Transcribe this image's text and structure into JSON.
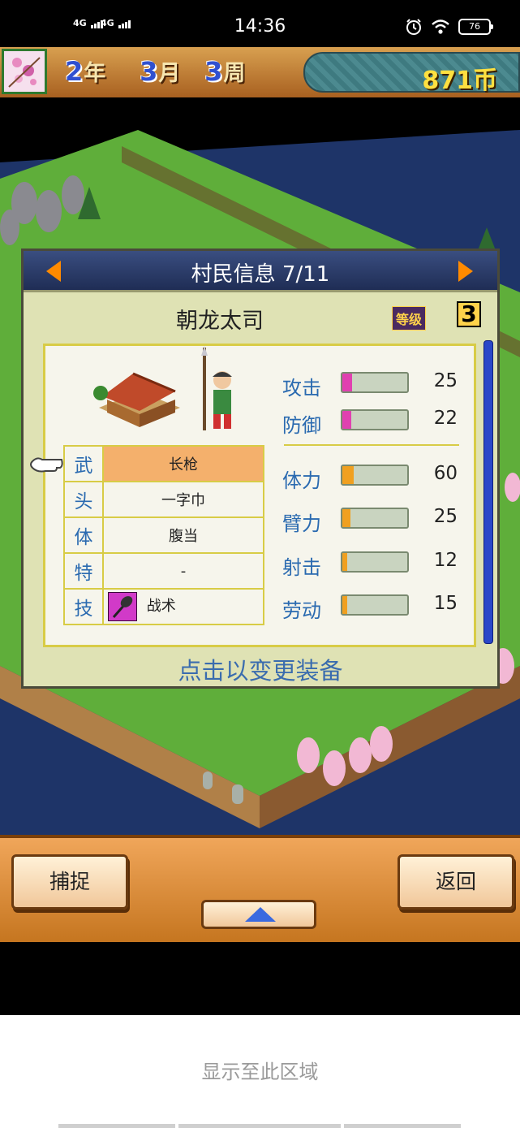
{
  "status_bar": {
    "time": "14:36",
    "signal_1": "4G",
    "signal_2": "4G",
    "battery": "76"
  },
  "top_bar": {
    "year_num": "2",
    "year_unit": "年",
    "month_num": "3",
    "month_unit": "月",
    "week_num": "3",
    "week_unit": "周",
    "coins": "871币"
  },
  "dialog": {
    "title": "村民信息 7/11",
    "villager_name": "朝龙太司",
    "level_label": "等级",
    "level_value": "3",
    "equipment": [
      {
        "slot": "武",
        "item": "长枪"
      },
      {
        "slot": "头",
        "item": "一字巾"
      },
      {
        "slot": "体",
        "item": "腹当"
      },
      {
        "slot": "特",
        "item": "-"
      },
      {
        "slot": "技",
        "item": "战术"
      }
    ],
    "stats": [
      {
        "label": "攻击",
        "value": "25",
        "fill": 0.15,
        "color": "#e040b0"
      },
      {
        "label": "防御",
        "value": "22",
        "fill": 0.14,
        "color": "#e040b0"
      },
      {
        "label": "体力",
        "value": "60",
        "fill": 0.17,
        "color": "#f0a020"
      },
      {
        "label": "臂力",
        "value": "25",
        "fill": 0.12,
        "color": "#f0a020"
      },
      {
        "label": "射击",
        "value": "12",
        "fill": 0.07,
        "color": "#f0a020"
      },
      {
        "label": "劳动",
        "value": "15",
        "fill": 0.08,
        "color": "#f0a020"
      }
    ],
    "footer_hint": "点击以变更装备"
  },
  "bottom_bar": {
    "capture_label": "捕捉",
    "back_label": "返回"
  },
  "system": {
    "display_hint": "显示至此区域"
  }
}
